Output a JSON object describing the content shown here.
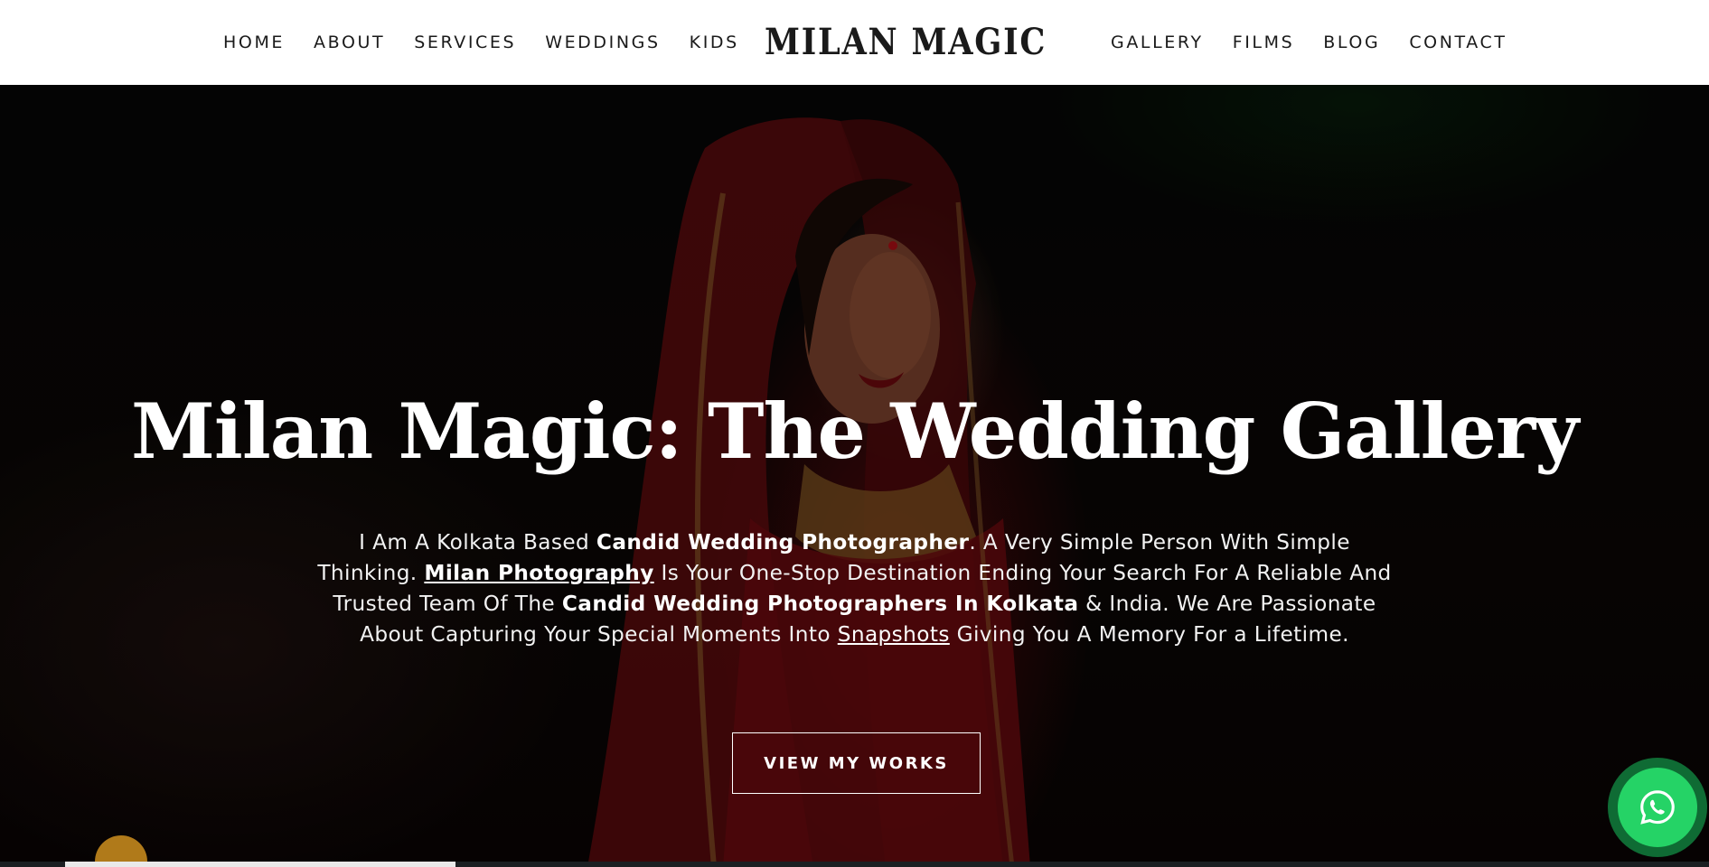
{
  "nav": {
    "left": [
      "HOME",
      "ABOUT",
      "SERVICES",
      "WEDDINGS",
      "KIDS"
    ],
    "right": [
      "GALLERY",
      "FILMS",
      "BLOG",
      "CONTACT"
    ],
    "logo": "MILAN MAGIC"
  },
  "hero": {
    "title": "Milan Magic: The Wedding Gallery",
    "text": {
      "p1": "I Am A Kolkata Based ",
      "b1": "Candid Wedding Photographer",
      "p2": ". A Very Simple Person With Simple Thinking. ",
      "link1": "Milan Photography",
      "p3": " Is Your One-Stop Destination Ending Your Search For A Reliable And Trusted Team Of The ",
      "b2": "Candid Wedding Photographers In Kolkata",
      "p4": " & India. We Are Passionate About Capturing Your Special Moments Into ",
      "link2": "Snapshots",
      "p5": " Giving You A Memory For a Lifetime."
    },
    "cta_label": "VIEW MY WORKS"
  },
  "whatsapp": {
    "icon": "whatsapp-icon",
    "color": "#25d366"
  },
  "colors": {
    "header_bg": "#ffffff",
    "nav_text": "#1a1a1a",
    "hero_text": "#ffffff"
  }
}
